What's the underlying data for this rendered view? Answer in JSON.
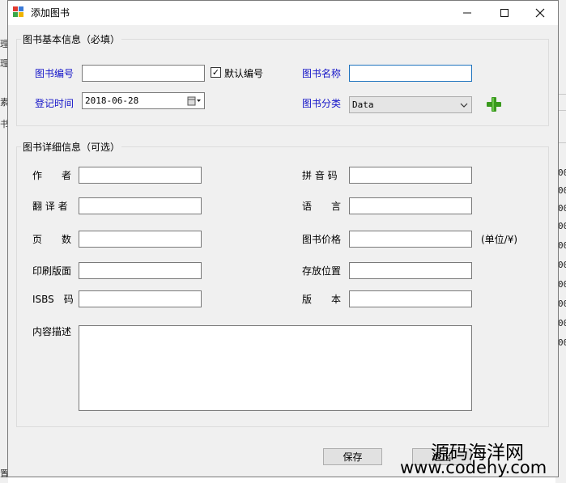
{
  "window": {
    "title": "添加图书",
    "minimize_glyph": "—",
    "maximize_glyph": "☐",
    "close_glyph": "✕"
  },
  "basic_group": {
    "title": "图书基本信息（必填）",
    "book_no_label": "图书编号",
    "book_no_value": "",
    "default_no_label": "默认编号",
    "default_no_checked": true,
    "book_name_label": "图书名称",
    "book_name_value": "",
    "reg_time_label": "登记时间",
    "reg_time_value": "2018-06-28",
    "category_label": "图书分类",
    "category_value": "Data",
    "add_category_icon": "plus-icon"
  },
  "detail_group": {
    "title": "图书详细信息（可选）",
    "author_label": "作　　者",
    "pinyin_label": "拼 音 码",
    "translator_label": "翻 译 者",
    "language_label": "语　　言",
    "pages_label": "页　　数",
    "price_label": "图书价格",
    "price_unit": "(单位/¥)",
    "print_layout_label": "印刷版面",
    "location_label": "存放位置",
    "isbs_label": "ISBS　码",
    "edition_label": "版　　本",
    "description_label": "内容描述",
    "author_value": "",
    "pinyin_value": "",
    "translator_value": "",
    "language_value": "",
    "pages_value": "",
    "price_value": "",
    "print_layout_value": "",
    "location_value": "",
    "isbs_value": "",
    "edition_value": "",
    "description_value": ""
  },
  "actions": {
    "save_label": "保存",
    "cancel_label": "退出"
  },
  "background": {
    "left_chars": [
      "理",
      "理",
      "素",
      "书"
    ],
    "right_nums": [
      "00",
      "00",
      "00",
      "00",
      "00",
      "00",
      "00",
      "00",
      "00",
      "00"
    ],
    "bottom_left_char": "置"
  },
  "watermark": {
    "line1": "源码海洋网",
    "line2": "www.codehy.com"
  },
  "colors": {
    "label_blue": "#1414c8",
    "plus_green": "#3a9a1e",
    "focus_border": "#1e73be"
  }
}
